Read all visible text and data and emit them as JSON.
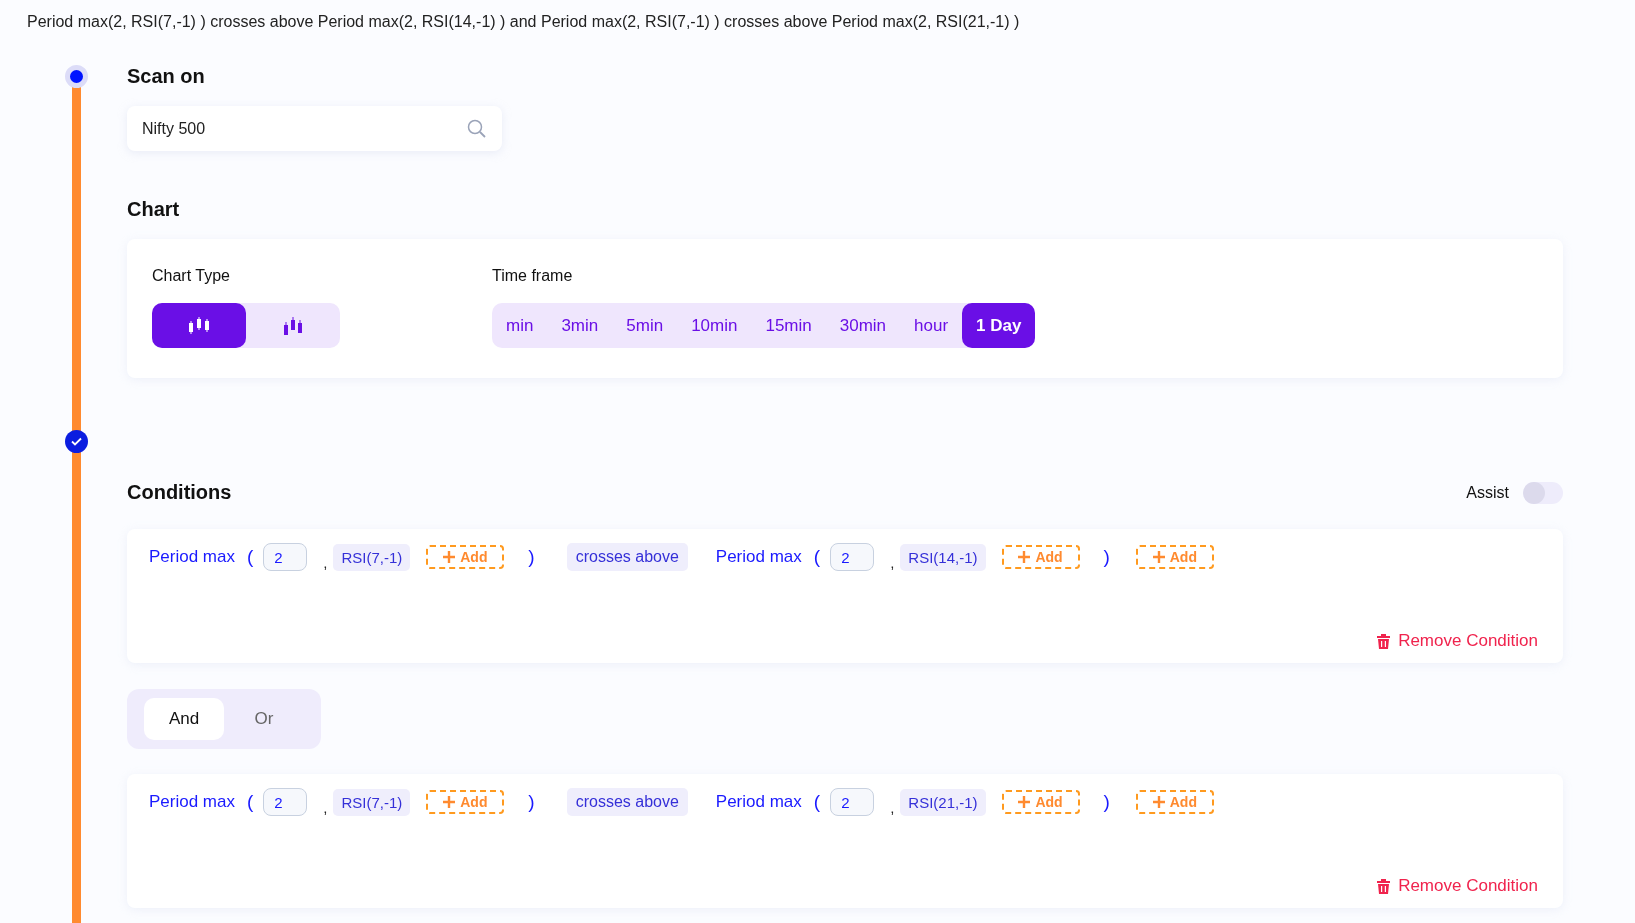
{
  "summary": "Period max(2, RSI(7,-1) ) crosses above Period max(2, RSI(14,-1) ) and Period max(2, RSI(7,-1) ) crosses above Period max(2, RSI(21,-1) )",
  "steps": [
    {
      "done": false
    },
    {
      "done": true
    }
  ],
  "scan": {
    "title": "Scan on",
    "value": "Nifty 500"
  },
  "chart": {
    "title": "Chart",
    "type_label": "Chart Type",
    "types": [
      {
        "kind": "candle",
        "selected": true
      },
      {
        "kind": "ohlc",
        "selected": false
      }
    ],
    "timeframe_label": "Time frame",
    "timeframes": [
      {
        "label": "min",
        "selected": false
      },
      {
        "label": "3min",
        "selected": false
      },
      {
        "label": "5min",
        "selected": false
      },
      {
        "label": "10min",
        "selected": false
      },
      {
        "label": "15min",
        "selected": false
      },
      {
        "label": "30min",
        "selected": false
      },
      {
        "label": "hour",
        "selected": false
      },
      {
        "label": "1 Day",
        "selected": true
      }
    ]
  },
  "conditions": {
    "title": "Conditions",
    "assist": {
      "label": "Assist",
      "on": false
    },
    "items": [
      {
        "tokens": [
          {
            "kind": "func",
            "text": "Period max"
          },
          {
            "kind": "paren",
            "text": "("
          },
          {
            "kind": "input",
            "text": "2"
          },
          {
            "kind": "comma",
            "text": ","
          },
          {
            "kind": "param",
            "text": "RSI(7,-1)"
          },
          {
            "kind": "add",
            "text": "Add"
          },
          {
            "kind": "paren",
            "text": ")"
          },
          {
            "kind": "op",
            "text": "crosses above"
          },
          {
            "kind": "func",
            "text": "Period max"
          },
          {
            "kind": "paren",
            "text": "("
          },
          {
            "kind": "input",
            "text": "2"
          },
          {
            "kind": "comma",
            "text": ","
          },
          {
            "kind": "param",
            "text": "RSI(14,-1)"
          },
          {
            "kind": "add",
            "text": "Add"
          },
          {
            "kind": "paren",
            "text": ")"
          },
          {
            "kind": "add",
            "text": "Add"
          }
        ],
        "remove": "Remove Condition"
      },
      {
        "join": [
          {
            "label": "And",
            "selected": true
          },
          {
            "label": "Or",
            "selected": false
          }
        ]
      },
      {
        "tokens": [
          {
            "kind": "func",
            "text": "Period max"
          },
          {
            "kind": "paren",
            "text": "("
          },
          {
            "kind": "input",
            "text": "2"
          },
          {
            "kind": "comma",
            "text": ","
          },
          {
            "kind": "param",
            "text": "RSI(7,-1)"
          },
          {
            "kind": "add",
            "text": "Add"
          },
          {
            "kind": "paren",
            "text": ")"
          },
          {
            "kind": "op",
            "text": "crosses above"
          },
          {
            "kind": "func",
            "text": "Period max"
          },
          {
            "kind": "paren",
            "text": "("
          },
          {
            "kind": "input",
            "text": "2"
          },
          {
            "kind": "comma",
            "text": ","
          },
          {
            "kind": "param",
            "text": "RSI(21,-1)"
          },
          {
            "kind": "add",
            "text": "Add"
          },
          {
            "kind": "paren",
            "text": ")"
          },
          {
            "kind": "add",
            "text": "Add"
          }
        ],
        "remove": "Remove Condition"
      }
    ]
  }
}
